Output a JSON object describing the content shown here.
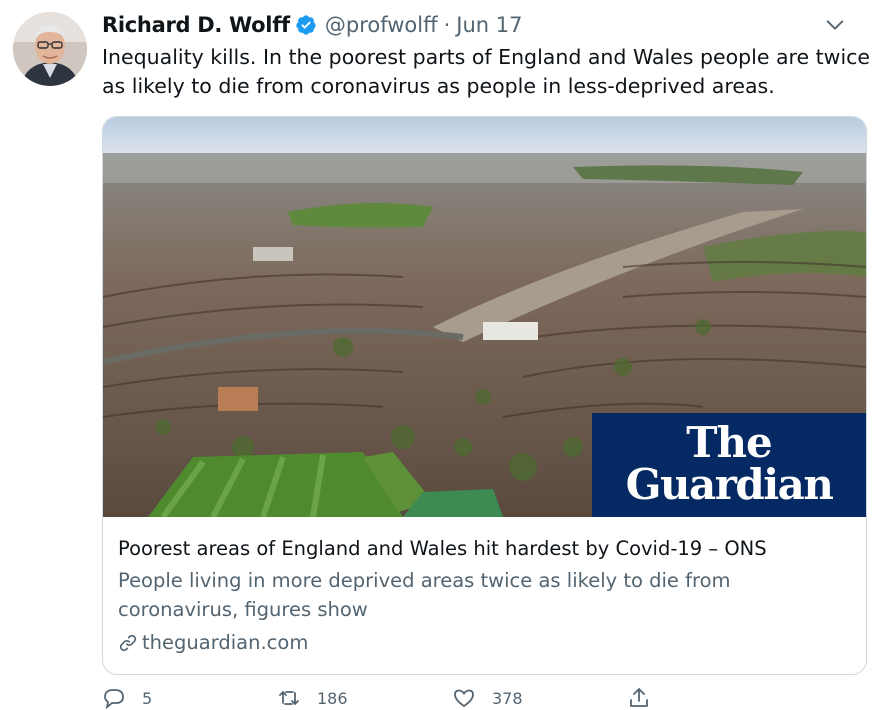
{
  "tweet": {
    "author_name": "Richard D. Wolff",
    "handle": "@profwolff",
    "separator": "·",
    "date": "Jun 17",
    "text": "Inequality kills. In the poorest parts of England and Wales people are twice as likely to die from coronavirus as people in less-deprived areas."
  },
  "card": {
    "image_alt": "Aerial view of houses",
    "brand_line1": "The",
    "brand_line2": "Guardian",
    "title": "Poorest areas of England and Wales hit hardest by Covid-19 – ONS",
    "description": "People living in more deprived areas twice as likely to die from coronavirus, figures show",
    "domain": "theguardian.com"
  },
  "actions": {
    "replies": "5",
    "retweets": "186",
    "likes": "378"
  },
  "colors": {
    "verified": "#1d9bf0",
    "guardian_navy": "#052962",
    "secondary_text": "#536471"
  }
}
